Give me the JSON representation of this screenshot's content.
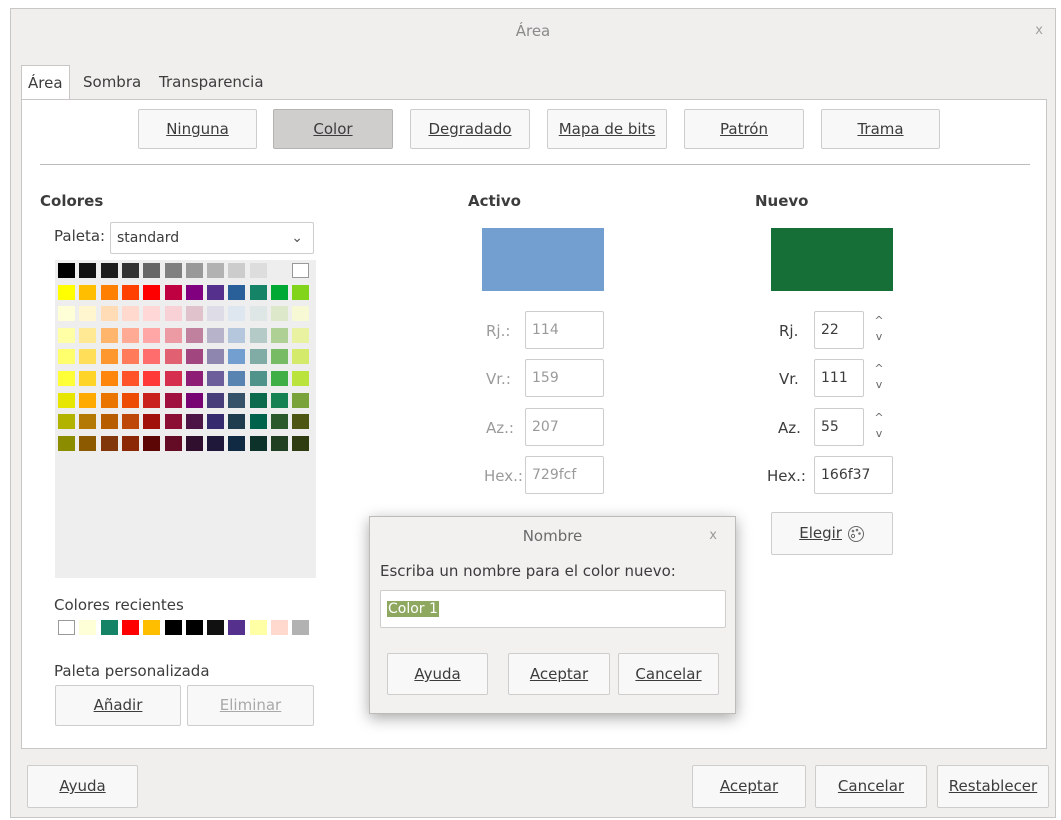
{
  "window": {
    "title": "Área",
    "close": "x"
  },
  "tabs": [
    "Área",
    "Sombra",
    "Transparencia"
  ],
  "fill_buttons": [
    {
      "label": "Ninguna",
      "pressed": false
    },
    {
      "label": "Color",
      "pressed": true
    },
    {
      "label": "Degradado",
      "pressed": false
    },
    {
      "label": "Mapa de bits",
      "pressed": false
    },
    {
      "label": "Patrón",
      "pressed": false
    },
    {
      "label": "Trama",
      "pressed": false
    }
  ],
  "colors": {
    "heading": "Colores",
    "palette_label": "Paleta:",
    "palette_value": "standard",
    "grid": [
      [
        "#000000",
        "#111111",
        "#1c1c1c",
        "#333333",
        "#666666",
        "#808080",
        "#999999",
        "#b2b2b2",
        "#cccccc",
        "#dddddd",
        "#eeeeee",
        "#ffffff"
      ],
      [
        "#ffff00",
        "#ffbf00",
        "#ff8000",
        "#ff4000",
        "#ff0000",
        "#bf0041",
        "#800080",
        "#55308d",
        "#2a6099",
        "#158466",
        "#00a933",
        "#81d41a"
      ],
      [
        "#ffffd7",
        "#fff5ce",
        "#ffdbb6",
        "#ffd8ce",
        "#ffd7d7",
        "#f7d1d5",
        "#e0c2cd",
        "#dedce6",
        "#dee6ef",
        "#dee7e5",
        "#dde8cb",
        "#f6f9d4"
      ],
      [
        "#ffffa6",
        "#ffe994",
        "#ffb66c",
        "#ffaa95",
        "#ffa6a6",
        "#ec9ba4",
        "#bf819e",
        "#b7b3ca",
        "#b4c7dc",
        "#b3cac7",
        "#afd095",
        "#e8f2a1"
      ],
      [
        "#ffff6d",
        "#ffde59",
        "#ff972f",
        "#ff7b59",
        "#ff6d6d",
        "#e16173",
        "#a1467e",
        "#8e86ae",
        "#729fcf",
        "#81aca6",
        "#77bc65",
        "#d4ea6b"
      ],
      [
        "#ffff38",
        "#ffd428",
        "#ff860d",
        "#ff5429",
        "#ff3838",
        "#d62e4e",
        "#8d1d75",
        "#6b5e9b",
        "#5983b0",
        "#50938a",
        "#3faf46",
        "#bbe33d"
      ],
      [
        "#e6e600",
        "#ffaa00",
        "#ea7500",
        "#ed4c05",
        "#c9211e",
        "#a1113f",
        "#780373",
        "#483e79",
        "#355269",
        "#0c6a4d",
        "#168253",
        "#79a23b"
      ],
      [
        "#b2b200",
        "#b47804",
        "#b85c00",
        "#be480a",
        "#a1100a",
        "#8b0e34",
        "#4d1546",
        "#352a6e",
        "#1e3c4e",
        "#00624b",
        "#2b592c",
        "#4d5613"
      ],
      [
        "#8c8c00",
        "#8c5a00",
        "#813709",
        "#8d2806",
        "#5d0606",
        "#640b26",
        "#2f0e2e",
        "#20183b",
        "#102a44",
        "#0d3229",
        "#213f21",
        "#2f3c12"
      ]
    ],
    "recent_label": "Colores recientes",
    "recent": [
      "#ffffff",
      "#ffffd7",
      "#158466",
      "#ff0000",
      "#ffbf00",
      "#000000",
      "#000000",
      "#111111",
      "#55308d",
      "#ffffa6",
      "#ffd8ce",
      "#b2b2b2"
    ],
    "custom_label": "Paleta personalizada",
    "add_label": "Añadir",
    "delete_label": "Eliminar"
  },
  "active": {
    "heading": "Activo",
    "color": "#729fcf",
    "r_label": "Rj.:",
    "r": "114",
    "g_label": "Vr.:",
    "g": "159",
    "b_label": "Az.:",
    "b": "207",
    "hex_label": "Hex.:",
    "hex": "729fcf"
  },
  "new": {
    "heading": "Nuevo",
    "color": "#166f37",
    "r_label": "Rj.",
    "r": "22",
    "g_label": "Vr.",
    "g": "111",
    "b_label": "Az.",
    "b": "55",
    "hex_label": "Hex.:",
    "hex": "166f37",
    "pick_label": "Elegir",
    "pick_icon": "color-picker-icon"
  },
  "name_dialog": {
    "title": "Nombre",
    "close": "x",
    "prompt": "Escriba un nombre para el color nuevo:",
    "value": "Color 1",
    "help": "Ayuda",
    "ok": "Aceptar",
    "cancel": "Cancelar"
  },
  "footer": {
    "help": "Ayuda",
    "ok": "Aceptar",
    "cancel": "Cancelar",
    "reset": "Restablecer"
  }
}
